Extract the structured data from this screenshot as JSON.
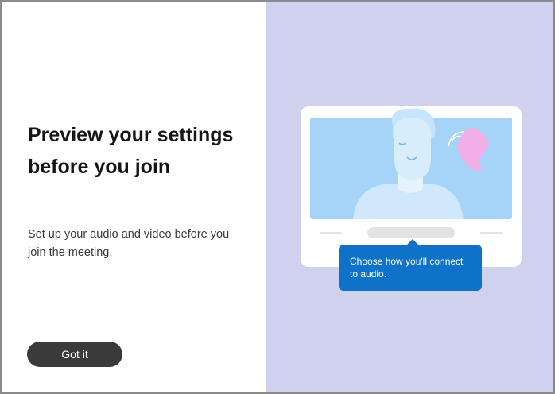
{
  "panel": {
    "title": "Preview your settings before you join",
    "description": "Set up your audio and video before you join the meeting.",
    "button_label": "Got it"
  },
  "tooltip": {
    "text": "Choose how you'll connect to audio."
  },
  "icons": {
    "call": "phone-icon",
    "person": "person-illustration"
  },
  "colors": {
    "right_background": "#cfd1ee",
    "button_background": "#3a3a3a",
    "tooltip_background": "#0e72c8",
    "screen_fill": "#a6d3f8",
    "phone_accent": "#f2aee6"
  }
}
